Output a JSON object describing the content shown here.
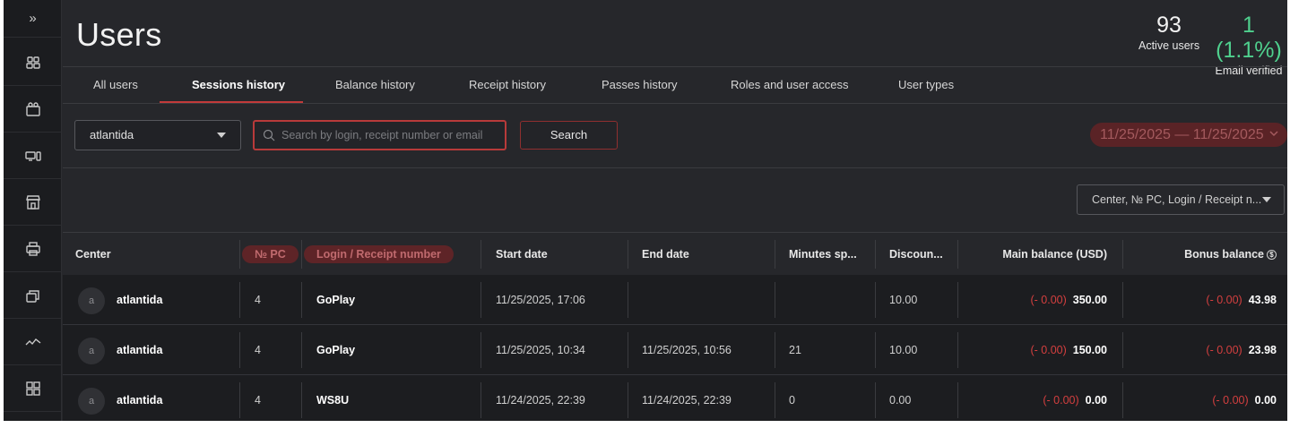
{
  "sidebar": {
    "expand_icon": "»",
    "items": [
      {
        "icon": "users-group-icon"
      },
      {
        "icon": "user-card-icon"
      },
      {
        "icon": "computers-icon"
      },
      {
        "icon": "store-icon"
      },
      {
        "icon": "printer-icon"
      },
      {
        "icon": "stack-icon"
      },
      {
        "icon": "analytics-icon"
      },
      {
        "icon": "grid-icon"
      }
    ]
  },
  "header": {
    "title": "Users",
    "stats": [
      {
        "value": "93",
        "label": "Active users"
      },
      {
        "value": "1 (1.1%)",
        "label": "Email verified"
      }
    ]
  },
  "tabs": [
    {
      "label": "All users",
      "active": false
    },
    {
      "label": "Sessions history",
      "active": true
    },
    {
      "label": "Balance history",
      "active": false
    },
    {
      "label": "Receipt history",
      "active": false
    },
    {
      "label": "Passes history",
      "active": false
    },
    {
      "label": "Roles and user access",
      "active": false
    },
    {
      "label": "User types",
      "active": false
    }
  ],
  "filters": {
    "center_select": "atlantida",
    "search_placeholder": "Search by login, receipt number or email",
    "search_value": "",
    "search_button": "Search",
    "date_range": "11/25/2025 — 11/25/2025",
    "columns_select": "Center, № PC, Login / Receipt n..."
  },
  "table": {
    "columns": [
      "Center",
      "№ PC",
      "Login / Receipt number",
      "Start date",
      "End date",
      "Minutes sp...",
      "Discoun...",
      "Main balance (USD)",
      "Bonus balance"
    ],
    "rows": [
      {
        "avatar": "a",
        "center": "atlantida",
        "pc": "4",
        "login": "GoPlay",
        "start": "11/25/2025, 17:06",
        "end": "",
        "minutes": "",
        "discount": "10.00",
        "main_delta": "(- 0.00)",
        "main_balance": "350.00",
        "bonus_delta": "(- 0.00)",
        "bonus_balance": "43.98"
      },
      {
        "avatar": "a",
        "center": "atlantida",
        "pc": "4",
        "login": "GoPlay",
        "start": "11/25/2025, 10:34",
        "end": "11/25/2025, 10:56",
        "minutes": "21",
        "discount": "10.00",
        "main_delta": "(- 0.00)",
        "main_balance": "150.00",
        "bonus_delta": "(- 0.00)",
        "bonus_balance": "23.98"
      },
      {
        "avatar": "a",
        "center": "atlantida",
        "pc": "4",
        "login": "WS8U",
        "start": "11/24/2025, 22:39",
        "end": "11/24/2025, 22:39",
        "minutes": "0",
        "discount": "0.00",
        "main_delta": "(- 0.00)",
        "main_balance": "0.00",
        "bonus_delta": "(- 0.00)",
        "bonus_balance": "0.00"
      }
    ]
  },
  "colors": {
    "accent_red": "#c23a3a",
    "verified_green": "#4fd08e",
    "background": "#26272b",
    "sidebar": "#1b1c1f"
  }
}
